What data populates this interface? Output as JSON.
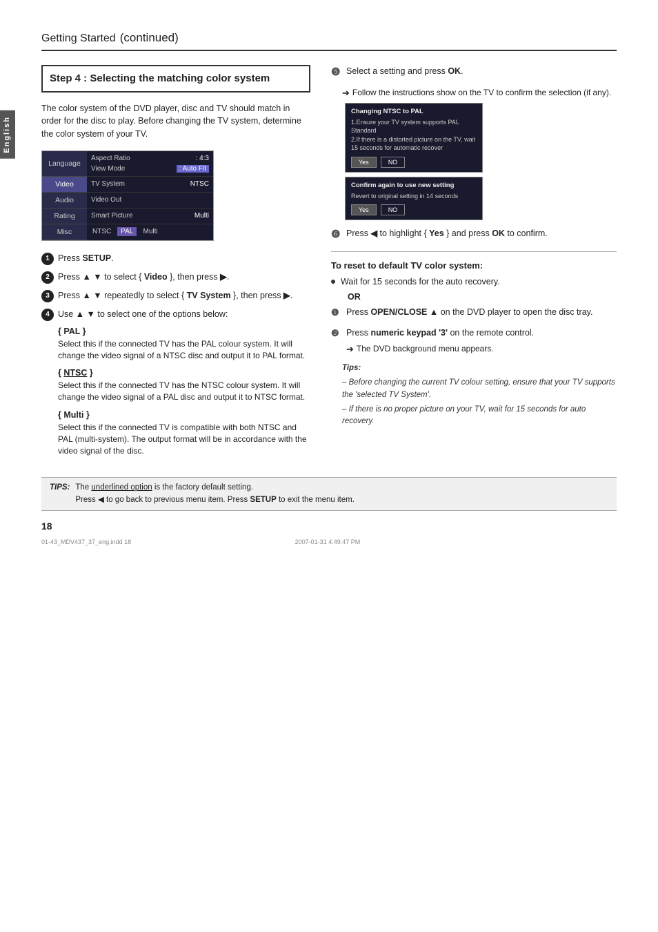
{
  "page": {
    "title": "Getting Started",
    "title_continued": "(continued)",
    "english_label": "English",
    "page_number": "18",
    "footer_file": "01-43_MDV437_37_eng.indd   18",
    "footer_date": "2007-01-31   4:49:47 PM"
  },
  "step": {
    "number": "Step 4 :",
    "title": "Selecting the matching color system"
  },
  "intro": "The color system of the DVD player, disc and TV should match in order for the disc to play. Before changing the TV system, determine the color system of your TV.",
  "menu": {
    "items": [
      {
        "label": "Language",
        "active": false
      },
      {
        "label": "Video",
        "active": true
      },
      {
        "label": "Audio",
        "active": false
      },
      {
        "label": "Rating",
        "active": false
      },
      {
        "label": "Misc",
        "active": false
      }
    ],
    "settings": [
      {
        "label": "Aspect Ratio",
        "value": ": 4:3"
      },
      {
        "label": "View Mode",
        "value": ": Auto Fit"
      },
      {
        "label": "TV System",
        "value": "NTSC"
      },
      {
        "label": "Video Out",
        "value": ""
      },
      {
        "label": "Smart Picture",
        "value": "Multi"
      }
    ],
    "tv_options": [
      "NTSC",
      "PAL",
      "Multi"
    ],
    "pal_highlighted": true
  },
  "left_steps": [
    {
      "num": "1",
      "text_before": "Press ",
      "bold": "SETUP",
      "text_after": "."
    },
    {
      "num": "2",
      "text_before": "Press ",
      "symbol1": "▲ ▼",
      "text_mid": " to select { ",
      "bold": "Video",
      "text_after": " }, then press ",
      "symbol2": "▶",
      "text_end": "."
    },
    {
      "num": "3",
      "text_before": "Press ",
      "symbol1": "▲ ▼",
      "text_mid": " repeatedly to select { ",
      "bold": "TV System",
      "text_after": " }, then press ",
      "symbol2": "▶",
      "text_end": "."
    },
    {
      "num": "4",
      "text_before": "Use ",
      "symbol1": "▲ ▼",
      "text_after": " to select one of the options below:"
    }
  ],
  "options": [
    {
      "title": "{ PAL }",
      "title_underline": false,
      "desc": "Select this if the connected TV has the PAL colour system. It will change the video signal of a NTSC disc and output it to PAL format."
    },
    {
      "title": "{ NTSC }",
      "title_underline": true,
      "desc": "Select this if the connected TV has the NTSC colour system. It will change the video signal of a PAL disc and output it to NTSC format."
    },
    {
      "title": "{ Multi }",
      "title_underline": false,
      "desc": "Select this if the connected TV is compatible with both NTSC and PAL (multi-system). The output format will be in accordance with the video signal of the disc."
    }
  ],
  "right_steps": [
    {
      "num": "5",
      "text_before": "Select a setting and press ",
      "bold": "OK",
      "text_after": ".",
      "sub": "Follow the instructions show on the TV to confirm the selection (if any)."
    },
    {
      "num": "6",
      "text_before": "Press ",
      "symbol": "◀",
      "text_mid": " to highlight { ",
      "bold": "Yes",
      "text_after": " } and press ",
      "bold2": "OK",
      "text_end": " to confirm."
    }
  ],
  "dialog1": {
    "title": "Changing NTSC to PAL",
    "body": "1.Ensure your TV system supports PAL Standard\n2.If there is a distorted picture on the TV, wait 15 seconds for automatic recover",
    "buttons": [
      "Yes",
      "NO"
    ]
  },
  "dialog2": {
    "title": "Confirm again to use new setting",
    "body": "Revert to original setting in 14 seconds",
    "buttons": [
      "Yes",
      "NO"
    ]
  },
  "reset_section": {
    "title": "To reset to default TV color system:",
    "bullets": [
      {
        "text": "Wait for 15 seconds for the auto recovery.",
        "sub": "OR"
      }
    ],
    "numbered": [
      {
        "num": "1",
        "text_before": "Press ",
        "bold": "OPEN/CLOSE ▲",
        "text_after": " on the DVD player to open the disc tray."
      },
      {
        "num": "2",
        "text_before": "Press ",
        "bold": "numeric keypad '3'",
        "text_after": " on the remote control.",
        "sub": "The DVD background menu appears."
      }
    ]
  },
  "tips_text": {
    "label": "Tips:",
    "items": [
      "– Before changing the current TV colour setting, ensure that your TV supports the 'selected TV System'.",
      "– If there is no proper picture on your TV, wait for 15 seconds for auto recovery."
    ]
  },
  "tips_bar": {
    "label": "TIPS:",
    "text1": "The ",
    "underline": "underlined option",
    "text2": " is the factory default setting.",
    "text3": "Press ◀ to go back to previous menu item. Press SETUP to exit the menu item."
  }
}
